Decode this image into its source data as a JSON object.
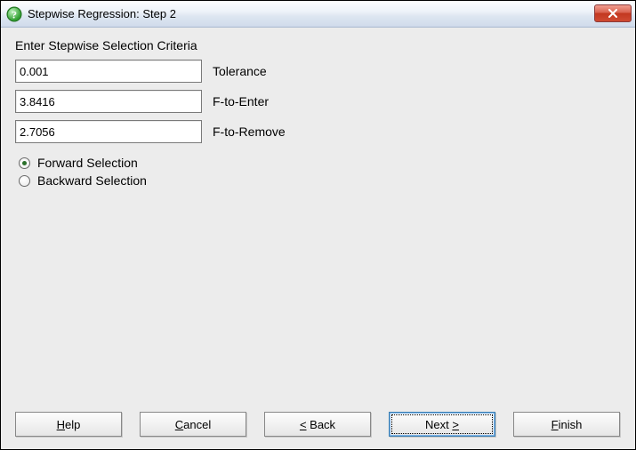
{
  "window": {
    "title": "Stepwise Regression: Step 2"
  },
  "heading": "Enter Stepwise Selection Criteria",
  "fields": {
    "tolerance": {
      "value": "0.001",
      "label": "Tolerance"
    },
    "fToEnter": {
      "value": "3.8416",
      "label": "F-to-Enter"
    },
    "fToRemove": {
      "value": "2.7056",
      "label": "F-to-Remove"
    }
  },
  "radios": {
    "forward": {
      "label": "Forward Selection",
      "checked": true
    },
    "backward": {
      "label": "Backward Selection",
      "checked": false
    }
  },
  "buttons": {
    "help": {
      "pre": "",
      "u": "H",
      "post": "elp"
    },
    "cancel": {
      "pre": "",
      "u": "C",
      "post": "ancel"
    },
    "back": {
      "pre": "",
      "u": "<",
      "post": " Back"
    },
    "next": {
      "pre": "Next ",
      "u": ">",
      "post": ""
    },
    "finish": {
      "pre": "",
      "u": "F",
      "post": "inish"
    }
  }
}
